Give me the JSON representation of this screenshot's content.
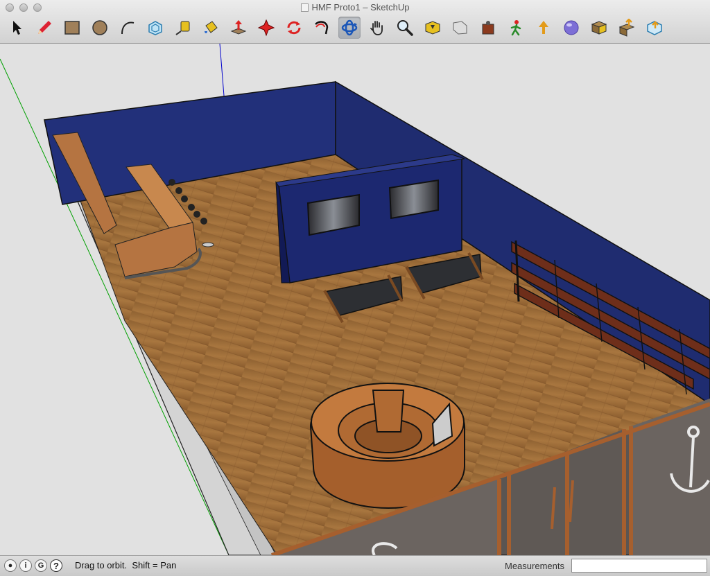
{
  "window": {
    "title": "HMF Proto1 – SketchUp",
    "buttons": [
      "close",
      "minimize",
      "zoom"
    ]
  },
  "toolbar": {
    "tools": [
      {
        "id": "select",
        "icon": "arrow-cursor-icon",
        "active": false
      },
      {
        "id": "pencil",
        "icon": "pencil-icon",
        "active": false
      },
      {
        "id": "rectangle",
        "icon": "rectangle-icon",
        "active": false
      },
      {
        "id": "circle",
        "icon": "circle-icon",
        "active": false
      },
      {
        "id": "arc",
        "icon": "arc-icon",
        "active": false
      },
      {
        "id": "offset",
        "icon": "offset-icon",
        "active": false
      },
      {
        "id": "tape-measure",
        "icon": "tape-measure-icon",
        "active": false
      },
      {
        "id": "paint-bucket",
        "icon": "paint-bucket-icon",
        "active": false
      },
      {
        "id": "push-pull",
        "icon": "push-pull-icon",
        "active": false
      },
      {
        "id": "move",
        "icon": "move-icon",
        "active": false
      },
      {
        "id": "rotate",
        "icon": "rotate-icon",
        "active": false
      },
      {
        "id": "follow-me",
        "icon": "follow-me-icon",
        "active": false
      },
      {
        "id": "orbit",
        "icon": "orbit-icon",
        "active": true
      },
      {
        "id": "pan",
        "icon": "hand-icon",
        "active": false
      },
      {
        "id": "zoom",
        "icon": "magnifier-icon",
        "active": false
      },
      {
        "id": "zoom-extents",
        "icon": "zoom-extents-icon",
        "active": false
      },
      {
        "id": "previous-view",
        "icon": "previous-view-icon",
        "active": false
      },
      {
        "id": "position-camera",
        "icon": "position-camera-icon",
        "active": false
      },
      {
        "id": "walk",
        "icon": "walk-icon",
        "active": false
      },
      {
        "id": "share-model",
        "icon": "share-model-icon",
        "active": false
      },
      {
        "id": "geo-location",
        "icon": "globe-icon",
        "active": false
      },
      {
        "id": "get-models",
        "icon": "get-models-icon",
        "active": false
      },
      {
        "id": "share-component",
        "icon": "share-component-icon",
        "active": false
      },
      {
        "id": "extension-warehouse",
        "icon": "extension-warehouse-icon",
        "active": false
      }
    ]
  },
  "statusbar": {
    "icons": [
      "geo-location-icon",
      "credits-icon",
      "google-sign-in-icon",
      "help-icon"
    ],
    "help_glyph": "?",
    "hint": "Drag to orbit.  Shift = Pan",
    "measurements_label": "Measurements",
    "measurements_value": ""
  },
  "colors": {
    "wall_blue": "#1e2a6b",
    "floor_wood": "#9a6a3a",
    "outer_wall": "#d9d9d9",
    "background": "#e1e1e1",
    "axis_red": "#c00000",
    "axis_green": "#00a000",
    "axis_blue": "#0000cc"
  }
}
